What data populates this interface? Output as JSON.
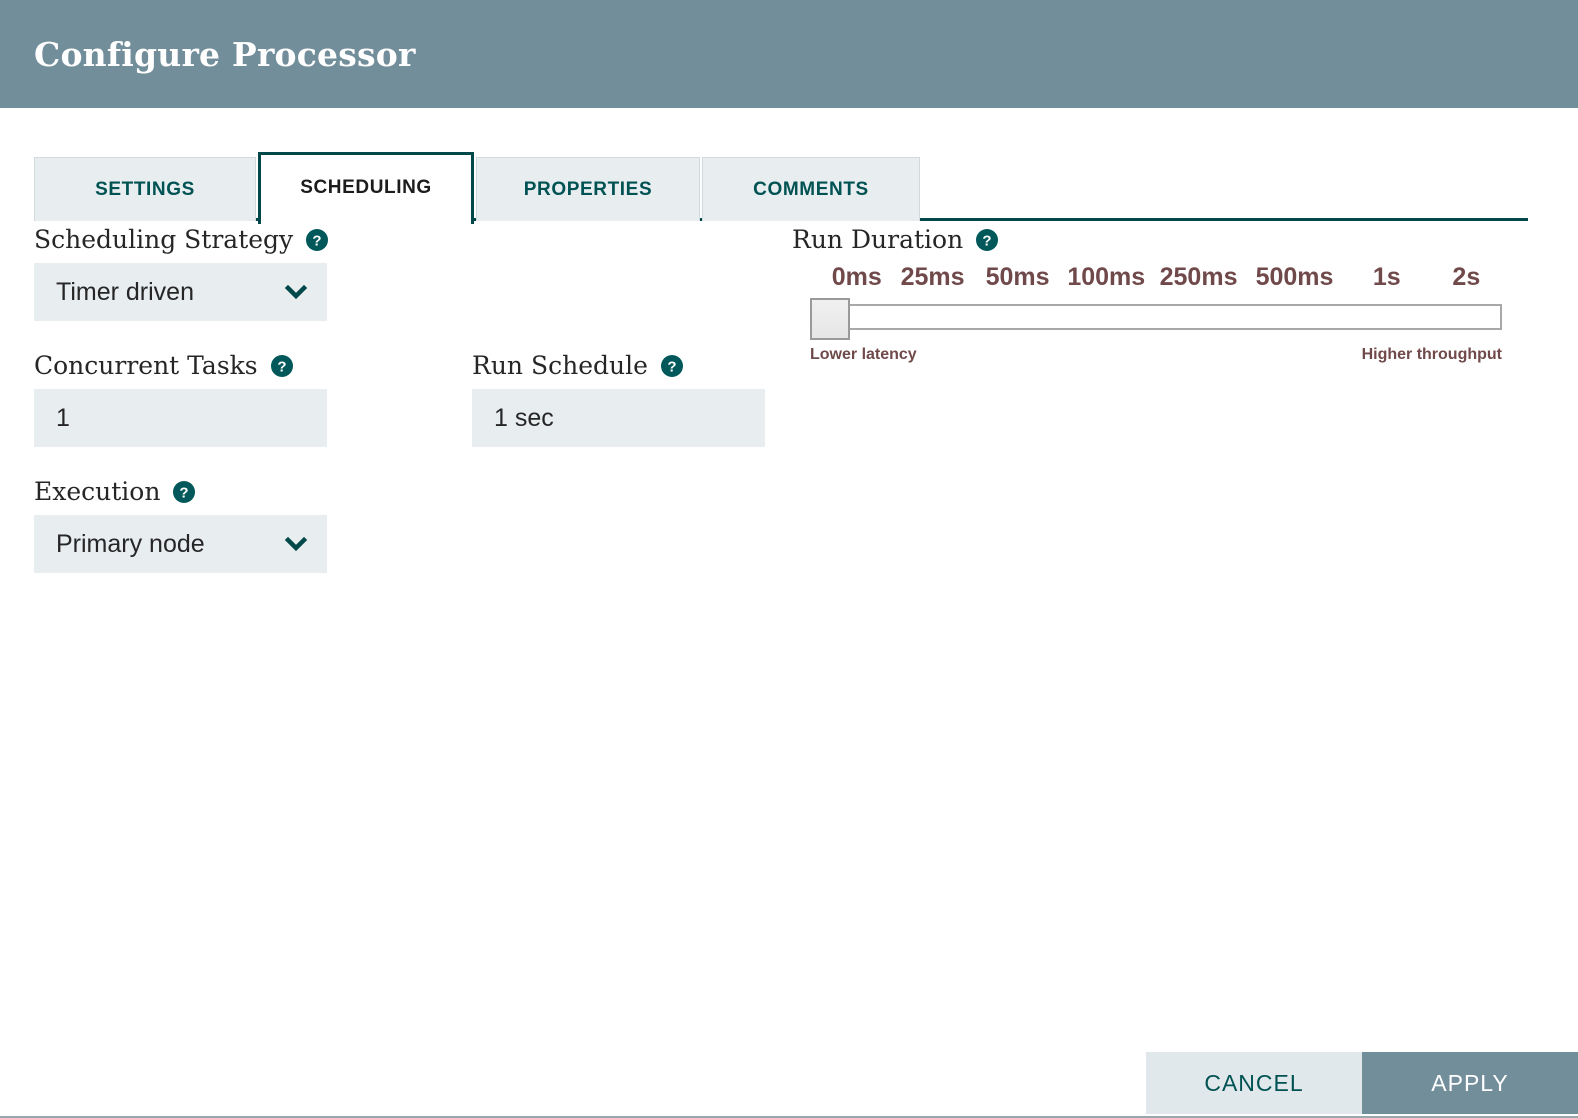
{
  "header": {
    "title": "Configure Processor"
  },
  "tabs": [
    {
      "label": "SETTINGS",
      "active": false
    },
    {
      "label": "SCHEDULING",
      "active": true
    },
    {
      "label": "PROPERTIES",
      "active": false
    },
    {
      "label": "COMMENTS",
      "active": false
    }
  ],
  "fields": {
    "scheduling_strategy": {
      "label": "Scheduling Strategy",
      "value": "Timer driven",
      "help_icon": "help-circle-icon",
      "chevron_icon": "chevron-down-icon"
    },
    "concurrent_tasks": {
      "label": "Concurrent Tasks",
      "value": "1",
      "placeholder": "",
      "help_icon": "help-circle-icon"
    },
    "execution": {
      "label": "Execution",
      "value": "Primary node",
      "help_icon": "help-circle-icon",
      "chevron_icon": "chevron-down-icon"
    },
    "run_schedule": {
      "label": "Run Schedule",
      "value": "1 sec",
      "placeholder": "",
      "help_icon": "help-circle-icon"
    },
    "run_duration": {
      "label": "Run Duration",
      "help_icon": "help-circle-icon",
      "ticks": [
        "0ms",
        "25ms",
        "50ms",
        "100ms",
        "250ms",
        "500ms",
        "1s",
        "2s"
      ],
      "selected_tick": "0ms",
      "left_end_label": "Lower latency",
      "right_end_label": "Higher throughput"
    }
  },
  "footer": {
    "cancel_label": "CANCEL",
    "apply_label": "APPLY"
  },
  "colors": {
    "header_bg": "#728e9b",
    "accent_teal": "#004849",
    "control_bg": "#e8edf0",
    "tick_text": "#70494a",
    "apply_bg": "#728e9b",
    "cancel_bg": "#e1e8eb"
  }
}
